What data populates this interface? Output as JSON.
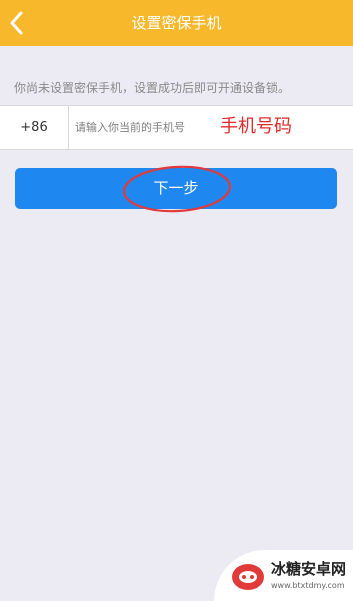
{
  "header": {
    "title": "设置密保手机",
    "bg_color": "#F8B82C",
    "back_icon": "chevron-left-icon"
  },
  "notice": "你尚未设置密保手机，设置成功后即可开通设备锁。",
  "phone": {
    "country_code": "+86",
    "placeholder": "请输入你当前的手机号",
    "annotation": "手机号码"
  },
  "next_button": {
    "label": "下一步",
    "color": "#1E88F0"
  },
  "watermark": {
    "name": "冰糖安卓网",
    "url": "www.btxtdmy.com"
  }
}
